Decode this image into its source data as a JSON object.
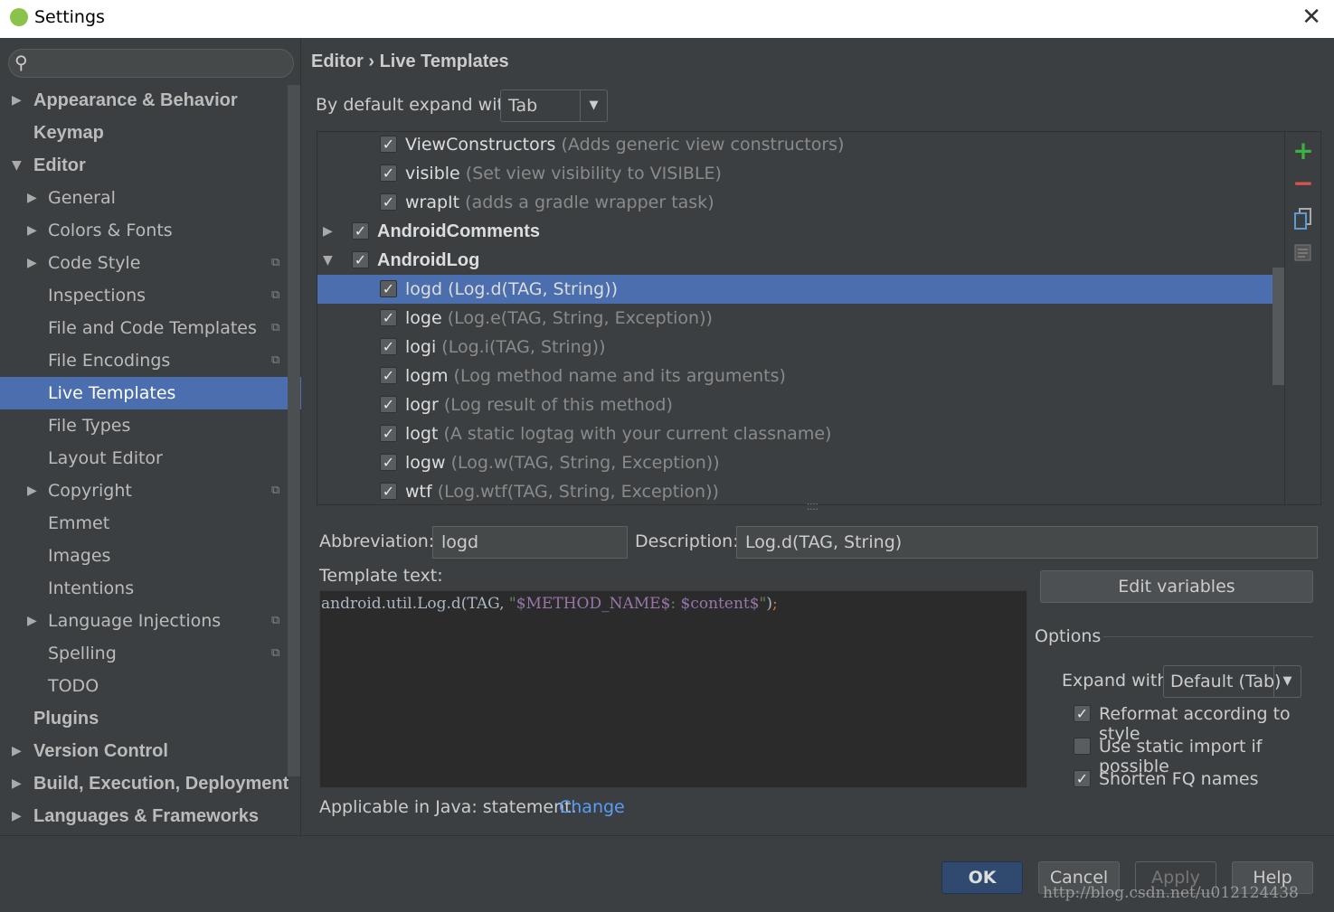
{
  "window": {
    "title": "Settings",
    "close_icon": "close-icon"
  },
  "sidebar": {
    "search_placeholder": "",
    "items": [
      {
        "label": "Appearance & Behavior",
        "level": 0,
        "arrow": "right",
        "bold": true
      },
      {
        "label": "Keymap",
        "level": 0,
        "arrow": "",
        "bold": true
      },
      {
        "label": "Editor",
        "level": 0,
        "arrow": "down",
        "bold": true
      },
      {
        "label": "General",
        "level": 1,
        "arrow": "right"
      },
      {
        "label": "Colors & Fonts",
        "level": 1,
        "arrow": "right"
      },
      {
        "label": "Code Style",
        "level": 1,
        "arrow": "right",
        "copy": true
      },
      {
        "label": "Inspections",
        "level": 1,
        "arrow": "",
        "copy": true
      },
      {
        "label": "File and Code Templates",
        "level": 1,
        "arrow": "",
        "copy": true
      },
      {
        "label": "File Encodings",
        "level": 1,
        "arrow": "",
        "copy": true
      },
      {
        "label": "Live Templates",
        "level": 1,
        "arrow": "",
        "selected": true
      },
      {
        "label": "File Types",
        "level": 1,
        "arrow": ""
      },
      {
        "label": "Layout Editor",
        "level": 1,
        "arrow": ""
      },
      {
        "label": "Copyright",
        "level": 1,
        "arrow": "right",
        "copy": true
      },
      {
        "label": "Emmet",
        "level": 1,
        "arrow": ""
      },
      {
        "label": "Images",
        "level": 1,
        "arrow": ""
      },
      {
        "label": "Intentions",
        "level": 1,
        "arrow": ""
      },
      {
        "label": "Language Injections",
        "level": 1,
        "arrow": "right",
        "copy": true
      },
      {
        "label": "Spelling",
        "level": 1,
        "arrow": "",
        "copy": true
      },
      {
        "label": "TODO",
        "level": 1,
        "arrow": ""
      },
      {
        "label": "Plugins",
        "level": 0,
        "arrow": "",
        "bold": true
      },
      {
        "label": "Version Control",
        "level": 0,
        "arrow": "right",
        "bold": true
      },
      {
        "label": "Build, Execution, Deployment",
        "level": 0,
        "arrow": "right",
        "bold": true
      },
      {
        "label": "Languages & Frameworks",
        "level": 0,
        "arrow": "right",
        "bold": true
      }
    ]
  },
  "main": {
    "breadcrumb": {
      "parent": "Editor",
      "sep": "›",
      "current": "Live Templates"
    },
    "expand_label": "By default expand with",
    "expand_value": "Tab",
    "templates": [
      {
        "name": "ViewConstructors",
        "desc": "(Adds generic view constructors)",
        "checked": true
      },
      {
        "name": "visible",
        "desc": "(Set view visibility to VISIBLE)",
        "checked": true
      },
      {
        "name": "wrapIt",
        "desc": "(adds a gradle wrapper task)",
        "checked": true
      },
      {
        "name": "AndroidComments",
        "desc": "",
        "group": true,
        "expanded": false,
        "checked": true
      },
      {
        "name": "AndroidLog",
        "desc": "",
        "group": true,
        "expanded": true,
        "checked": true
      },
      {
        "name": "logd",
        "desc": "(Log.d(TAG, String))",
        "checked": true,
        "selected": true
      },
      {
        "name": "loge",
        "desc": "(Log.e(TAG, String, Exception))",
        "checked": true
      },
      {
        "name": "logi",
        "desc": "(Log.i(TAG, String))",
        "checked": true
      },
      {
        "name": "logm",
        "desc": "(Log method name and its arguments)",
        "checked": true
      },
      {
        "name": "logr",
        "desc": "(Log result of this method)",
        "checked": true
      },
      {
        "name": "logt",
        "desc": "(A static logtag with your current classname)",
        "checked": true
      },
      {
        "name": "logw",
        "desc": "(Log.w(TAG, String, Exception))",
        "checked": true
      },
      {
        "name": "wtf",
        "desc": "(Log.wtf(TAG, String, Exception))",
        "checked": true
      }
    ],
    "toolbar": {
      "add": "+",
      "remove": "−",
      "add_color": "#3cb043",
      "remove_color": "#d9534f"
    },
    "abbreviation_label": "Abbreviation:",
    "abbreviation": "logd",
    "description_label": "Description:",
    "description": "Log.d(TAG, String)",
    "template_text_label": "Template text:",
    "template_text": {
      "a": "android.util.Log.d(TAG, ",
      "b": "\"",
      "c": "$METHOD_NAME$",
      "d": ": ",
      "e": "$content$",
      "f": "\"",
      "g": ")",
      "h": ";"
    },
    "edit_variables": "Edit variables",
    "options": {
      "title": "Options",
      "expand_with_label": "Expand with",
      "expand_with_value": "Default (Tab)",
      "reformat": {
        "label": "Reformat according to style",
        "checked": true
      },
      "static_import": {
        "label": "Use static import if possible",
        "checked": false
      },
      "shorten_fq": {
        "label": "Shorten FQ names",
        "checked": true
      }
    },
    "applicable": "Applicable in Java: statement.",
    "change": "Change"
  },
  "footer": {
    "ok": "OK",
    "cancel": "Cancel",
    "apply": "Apply",
    "help": "Help"
  },
  "watermark": "http://blog.csdn.net/u012124438",
  "colors": {
    "selection": "#4b6eaf",
    "background": "#3c3f41",
    "editor": "#2b2b2b",
    "link": "#589df6"
  }
}
